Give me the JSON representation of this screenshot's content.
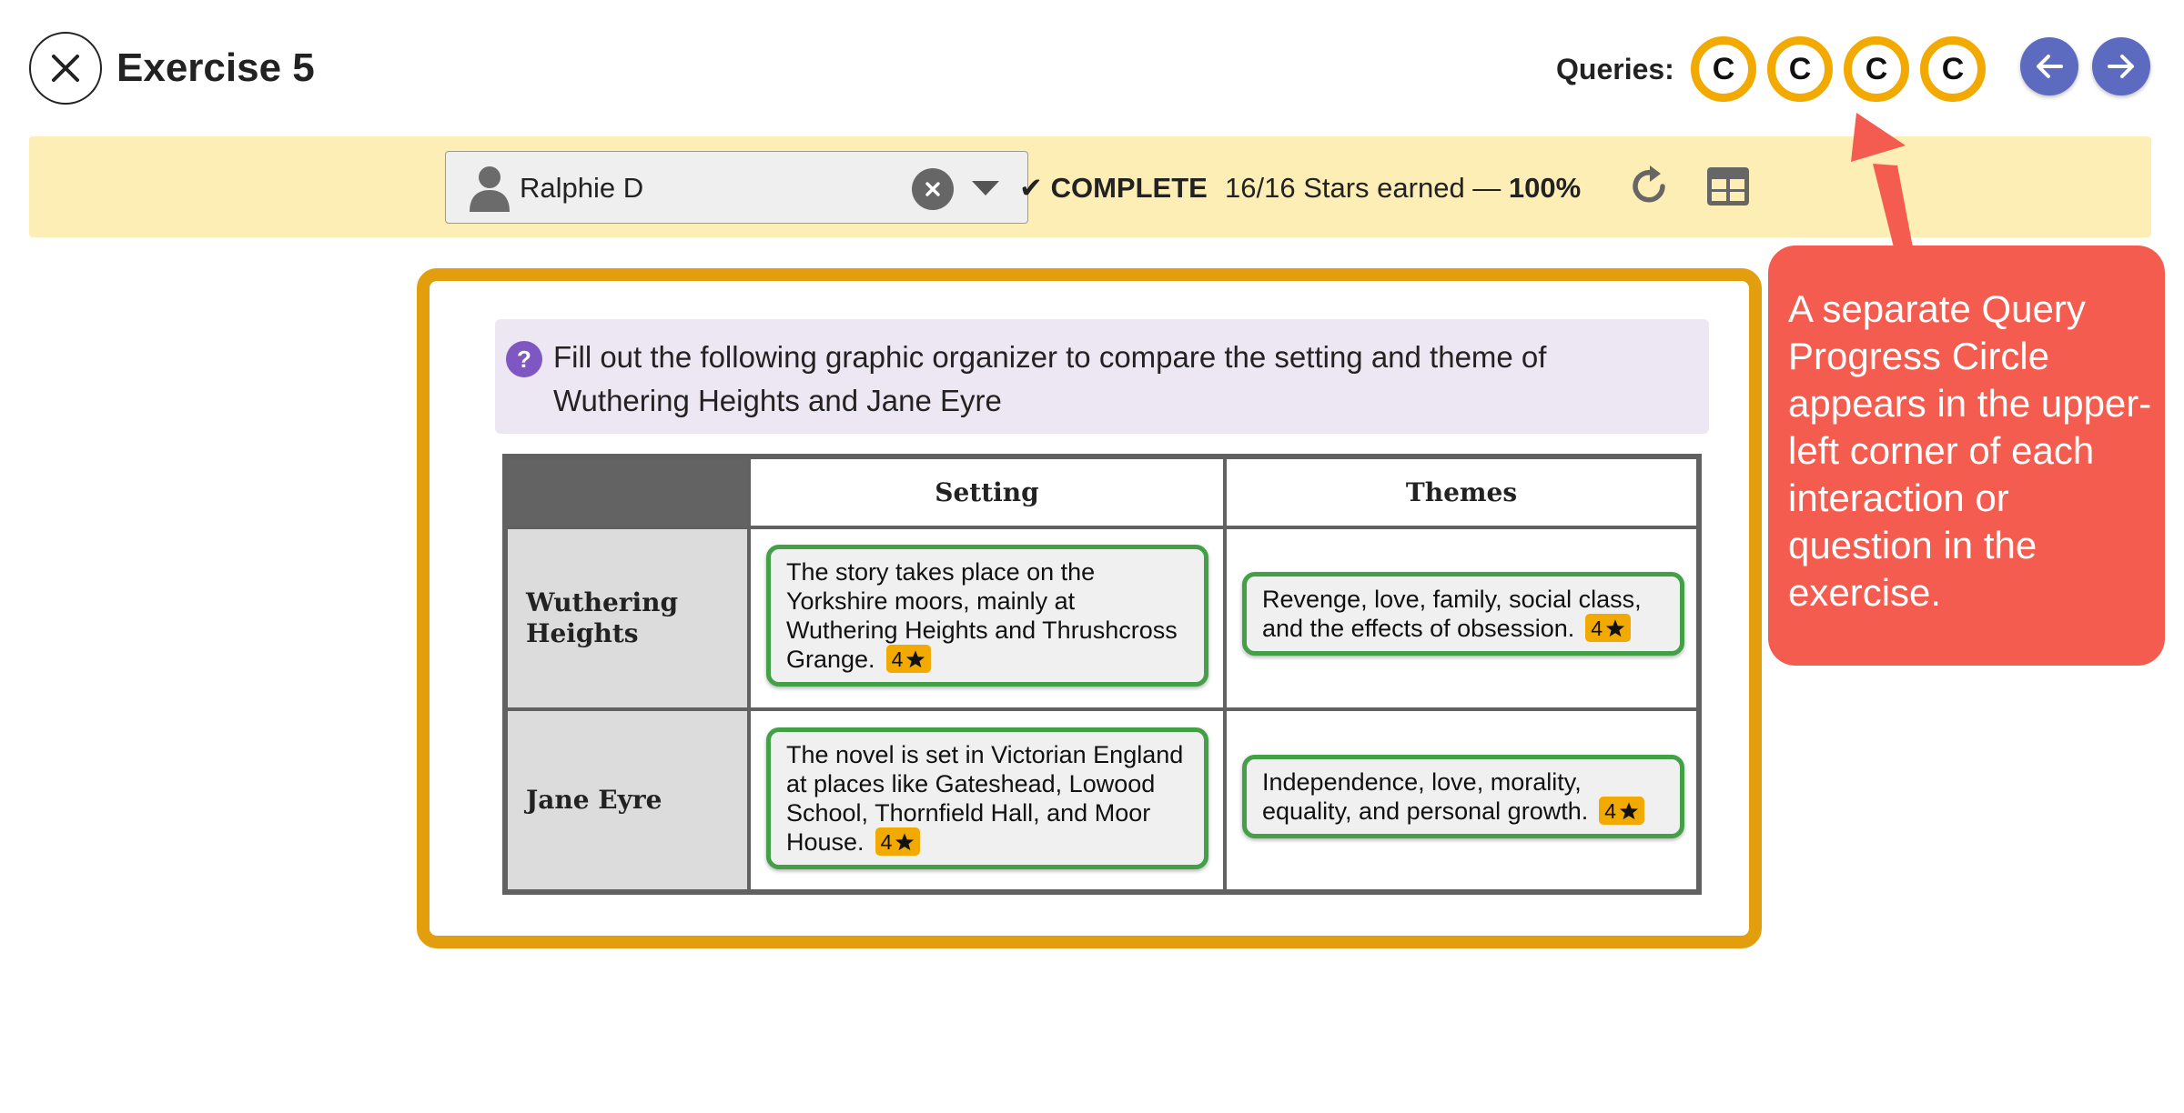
{
  "header": {
    "title": "Exercise 5",
    "queries_label": "Queries:",
    "query_circles": [
      "C",
      "C",
      "C",
      "C"
    ]
  },
  "status": {
    "student": "Ralphie D",
    "complete": "✔ COMPLETE",
    "stars_text": "16/16 Stars earned — ",
    "percent": "100%"
  },
  "question": {
    "text": "Fill out the following graphic organizer to compare the setting and theme of Wuthering Heights and Jane Eyre"
  },
  "organizer": {
    "columns": [
      "Setting",
      "Themes"
    ],
    "rows": [
      {
        "label": "Wuthering Heights",
        "setting": "The story takes place on the Yorkshire moors, mainly at Wuthering Heights and Thrushcross Grange.",
        "setting_stars": "4",
        "themes": "Revenge, love, family, social class, and the effects of obsession.",
        "themes_stars": "4"
      },
      {
        "label": "Jane Eyre",
        "setting": "The novel is set in Victorian England at places like Gateshead, Lowood School, Thornfield Hall, and Moor House.",
        "setting_stars": "4",
        "themes": "Independence, love, morality, equality, and personal growth.",
        "themes_stars": "4"
      }
    ]
  },
  "callout": {
    "text": "A separate Query Progress Circle appears in the upper-left corner of each interaction or question in the exercise."
  },
  "colors": {
    "accent_gold": "#f2a900",
    "card_border": "#e29e0c",
    "status_bar": "#fdeeb6",
    "nav_button": "#5c6bc0",
    "answer_border": "#43a047",
    "callout": "#f45c50",
    "question_bg": "#ede7f3"
  },
  "icons": [
    "close-icon",
    "arrow-left-icon",
    "arrow-right-icon",
    "person-icon",
    "clear-icon",
    "chevron-down-icon",
    "reload-icon",
    "table-icon",
    "help-icon",
    "star-icon"
  ]
}
